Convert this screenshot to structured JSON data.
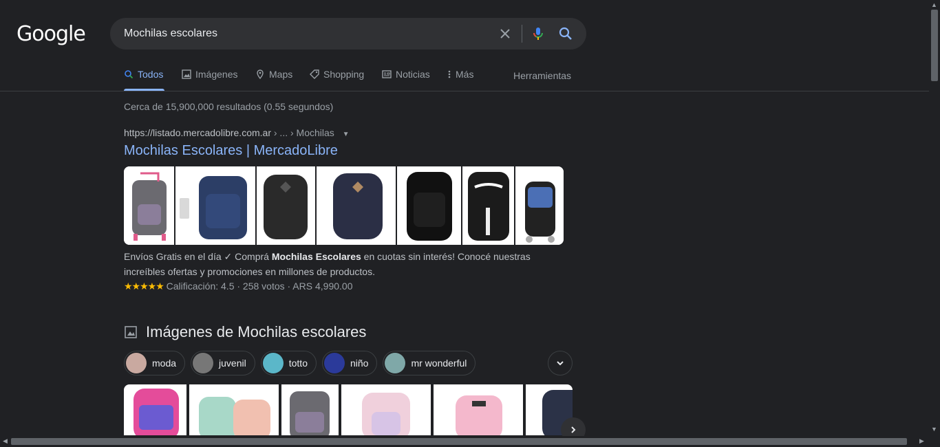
{
  "header": {
    "logo_text": "Google",
    "search": {
      "value": "Mochilas escolares",
      "placeholder": ""
    }
  },
  "tabs": [
    {
      "label": "Todos",
      "icon": "search-icon",
      "active": true
    },
    {
      "label": "Imágenes",
      "icon": "image-icon"
    },
    {
      "label": "Maps",
      "icon": "map-pin-icon"
    },
    {
      "label": "Shopping",
      "icon": "tag-icon"
    },
    {
      "label": "Noticias",
      "icon": "newspaper-icon"
    },
    {
      "label": "Más",
      "icon": "more-vert-icon"
    }
  ],
  "tools_label": "Herramientas",
  "stats": "Cerca de 15,900,000 resultados (0.55 segundos)",
  "result": {
    "url": "https://listado.mercadolibre.com.ar",
    "breadcrumb": " › ... › Mochilas",
    "title": "Mochilas Escolares | MercadoLibre",
    "snippet_pre": "Envíos Gratis en el día ✓ Comprá ",
    "snippet_bold": "Mochilas Escolares",
    "snippet_post": " en cuotas sin interés! Conocé nuestras increíbles ofertas y promociones en millones de productos.",
    "stars": "★★★★★",
    "rating_text": "Calificación: 4.5 · 258 votos · ARS 4,990.00",
    "rating_value": 4.5
  },
  "images_section": {
    "title": "Imágenes de Mochilas escolares",
    "chips": [
      "moda",
      "juvenil",
      "totto",
      "niño",
      "mr wonderful"
    ]
  },
  "colors": {
    "background": "#202124",
    "link": "#8ab4f8",
    "star": "#fbbc04"
  }
}
